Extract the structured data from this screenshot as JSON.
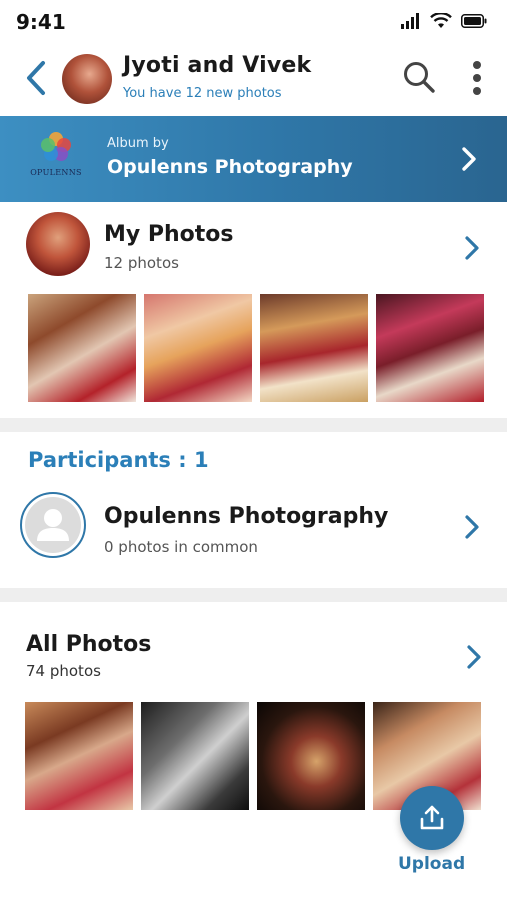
{
  "status_bar": {
    "time": "9:41"
  },
  "header": {
    "title": "Jyoti and Vivek",
    "subtitle": "You have 12 new photos"
  },
  "banner": {
    "caption": "Album by",
    "name": "Opulenns Photography",
    "logo_text": "OPULENNS"
  },
  "my_photos": {
    "title": "My Photos",
    "count": "12 photos",
    "thumbnails": [
      {
        "description": "wedding ritual"
      },
      {
        "description": "bride under canopy"
      },
      {
        "description": "garland exchange"
      },
      {
        "description": "couple with flower wall"
      }
    ]
  },
  "participants": {
    "title": "Participants : 1",
    "items": [
      {
        "name": "Opulenns Photography",
        "subtitle": "0 photos in common"
      }
    ]
  },
  "all_photos": {
    "title": "All Photos",
    "count": "74 photos",
    "thumbnails": [
      {
        "description": "couple at ceremony"
      },
      {
        "description": "couple close-up bw"
      },
      {
        "description": "couple with garlands"
      },
      {
        "description": "couple smiling"
      }
    ]
  },
  "upload": {
    "label": "Upload"
  },
  "colors": {
    "accent": "#2f77a8",
    "accent_light": "#2b7fb8",
    "divider": "#eeeeee"
  }
}
